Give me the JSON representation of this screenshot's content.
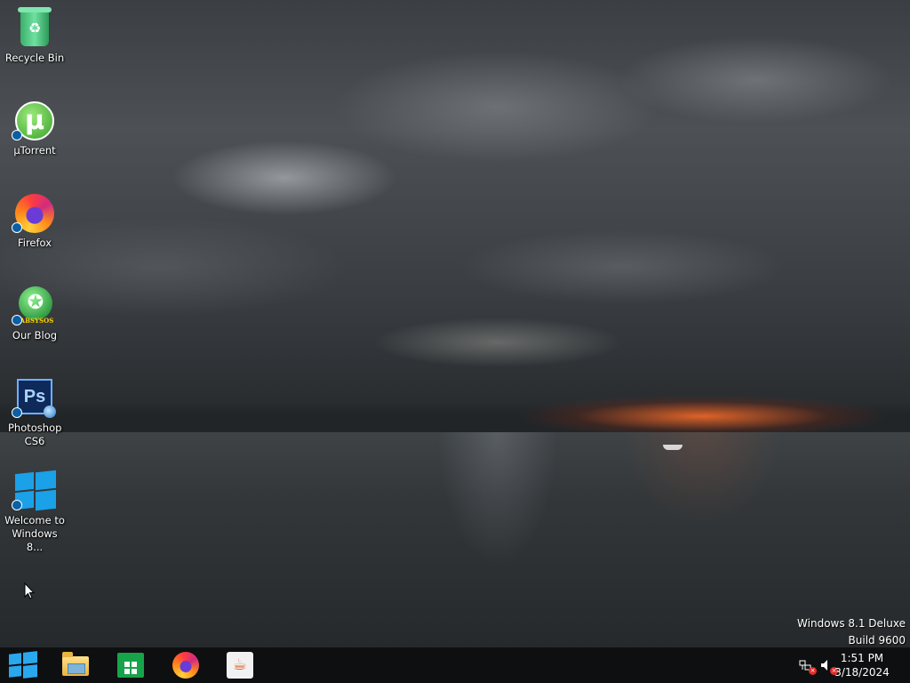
{
  "desktop": {
    "icons": [
      {
        "label": "Recycle Bin",
        "icon": "recycle-bin-icon"
      },
      {
        "label": "µTorrent",
        "icon": "utorrent-icon"
      },
      {
        "label": "Firefox",
        "icon": "firefox-icon"
      },
      {
        "label": "Our Blog",
        "icon": "blog-icon",
        "logo_text": "LABSYSOS"
      },
      {
        "label": "Photoshop CS6",
        "icon": "photoshop-icon",
        "logo_text": "Ps"
      },
      {
        "label": "Welcome to Windows 8...",
        "icon": "windows-logo-icon"
      }
    ]
  },
  "watermark": {
    "line1": "Windows 8.1 Deluxe",
    "line2": "Build 9600"
  },
  "taskbar": {
    "pinned": [
      {
        "name": "start",
        "icon": "windows-logo-icon"
      },
      {
        "name": "file-explorer",
        "icon": "folder-icon"
      },
      {
        "name": "store",
        "icon": "store-icon"
      },
      {
        "name": "firefox",
        "icon": "firefox-icon"
      },
      {
        "name": "java",
        "icon": "java-icon"
      }
    ],
    "tray": {
      "network_icon": "network-disconnected-icon",
      "volume_icon": "volume-muted-icon"
    },
    "clock": {
      "time": "1:51 PM",
      "date": "3/18/2024"
    }
  },
  "colors": {
    "taskbar": "#0e0f11",
    "accent": "#1aa1e8"
  }
}
